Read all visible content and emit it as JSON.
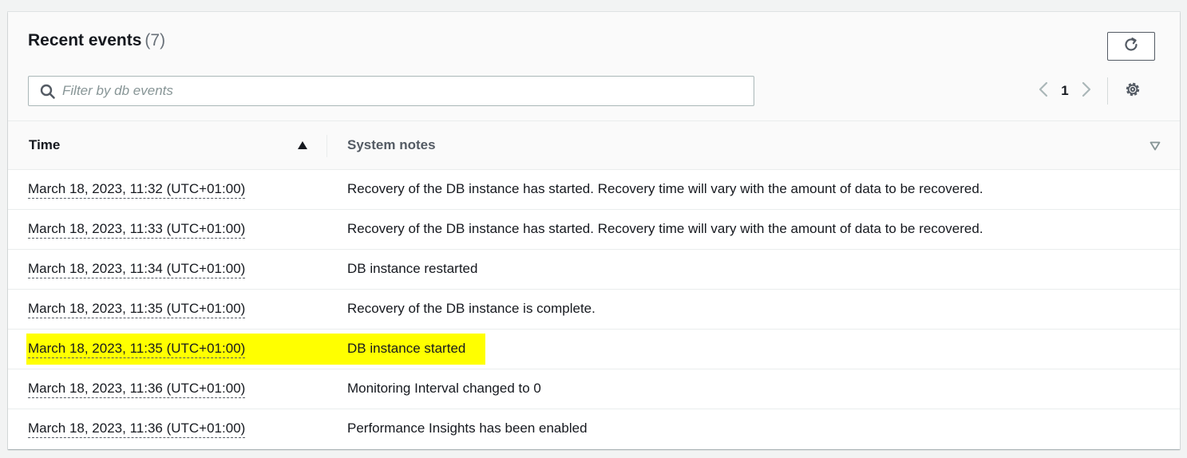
{
  "header": {
    "title": "Recent events",
    "count": "(7)",
    "refresh_icon": "refresh-icon"
  },
  "search": {
    "placeholder": "Filter by db events",
    "value": "",
    "icon": "search-icon"
  },
  "pagination": {
    "current_page": "1",
    "prev_icon": "chevron-left-icon",
    "next_icon": "chevron-right-icon",
    "settings_icon": "gear-icon"
  },
  "table": {
    "columns": [
      {
        "label": "Time",
        "sort": "ascending"
      },
      {
        "label": "System notes",
        "sort": "none"
      }
    ],
    "rows": [
      {
        "time": "March 18, 2023, 11:32 (UTC+01:00)",
        "notes": "Recovery of the DB instance has started. Recovery time will vary with the amount of data to be recovered.",
        "highlighted": false
      },
      {
        "time": "March 18, 2023, 11:33 (UTC+01:00)",
        "notes": "Recovery of the DB instance has started. Recovery time will vary with the amount of data to be recovered.",
        "highlighted": false
      },
      {
        "time": "March 18, 2023, 11:34 (UTC+01:00)",
        "notes": "DB instance restarted",
        "highlighted": false
      },
      {
        "time": "March 18, 2023, 11:35 (UTC+01:00)",
        "notes": "Recovery of the DB instance is complete.",
        "highlighted": false
      },
      {
        "time": "March 18, 2023, 11:35 (UTC+01:00)",
        "notes": "DB instance started",
        "highlighted": true
      },
      {
        "time": "March 18, 2023, 11:36 (UTC+01:00)",
        "notes": "Monitoring Interval changed to 0",
        "highlighted": false
      },
      {
        "time": "March 18, 2023, 11:36 (UTC+01:00)",
        "notes": "Performance Insights has been enabled",
        "highlighted": false
      }
    ]
  },
  "colors": {
    "highlight": "#ffff00",
    "text": "#16191f",
    "muted": "#687078",
    "border": "#eaeded"
  }
}
